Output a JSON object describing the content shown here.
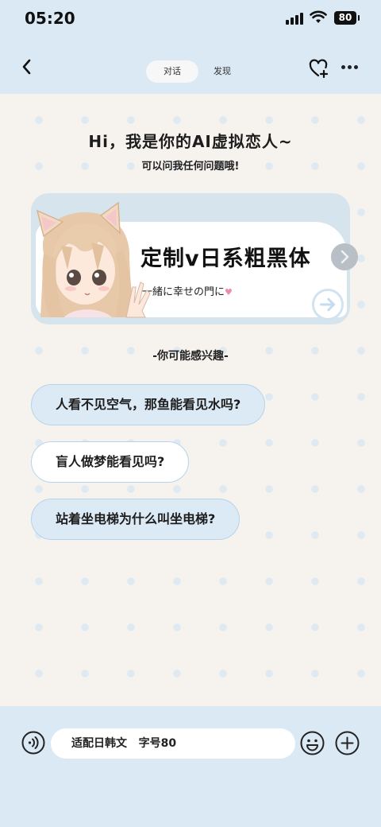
{
  "status_bar": {
    "time": "05:20",
    "battery": "80"
  },
  "nav": {
    "tabs": [
      {
        "label": "对话",
        "active": true
      },
      {
        "label": "发现",
        "active": false
      }
    ]
  },
  "greeting": {
    "title": "Hi，我是你的AI虚拟恋人~",
    "subtitle": "可以问我任何问题哦!"
  },
  "banner": {
    "title": "定制v日系粗黑体",
    "subtitle": "一緒に幸せの門に"
  },
  "interests": {
    "title": "-你可能感兴趣-",
    "items": [
      "人看不见空气，那鱼能看见水吗?",
      "盲人做梦能看见吗?",
      "站着坐电梯为什么叫坐电梯?"
    ]
  },
  "composer": {
    "placeholder": "适配日韩文   字号80"
  },
  "colors": {
    "accent_bg": "#dbe9f5",
    "chip_bg": "#dceaf6",
    "chip_border": "#b7d3ea"
  },
  "icons": [
    "back-icon",
    "heart-plus-icon",
    "more-icon",
    "chevron-right-icon",
    "arrow-right-icon",
    "voice-icon",
    "emoji-icon",
    "plus-icon"
  ]
}
